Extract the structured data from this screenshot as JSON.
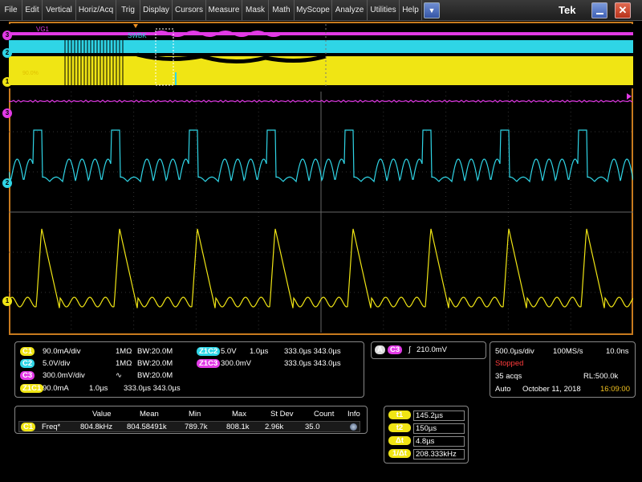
{
  "menu": {
    "items": [
      "File",
      "Edit",
      "Vertical",
      "Horiz/Acq",
      "Trig",
      "Display",
      "Cursors",
      "Measure",
      "Mask",
      "Math",
      "MyScope",
      "Analyze",
      "Utilities",
      "Help"
    ],
    "brand": "Tek",
    "dropdown_glyph": "▼",
    "close_glyph": "✕"
  },
  "overview": {
    "labels": {
      "vg1": "VG1",
      "swbk": "SWBK",
      "cursor_region": "90.0%"
    },
    "channel_markers": [
      "3",
      "2",
      "1"
    ]
  },
  "graticule": {
    "channel_markers": [
      "3",
      "2",
      "1"
    ],
    "trace_colors": {
      "ch1": "#f0e514",
      "ch2": "#2fd5e6",
      "ch3": "#e23ae6",
      "ch4": "#6df05a"
    }
  },
  "vertical_panel": {
    "rows": [
      {
        "badge": "C1",
        "badge_color": "#f0e514",
        "scale": "90.0mA/div",
        "imp": "1MΩ",
        "bw": "BW:20.0M"
      },
      {
        "badge": "C2",
        "badge_color": "#2fd5e6",
        "scale": "5.0V/div",
        "imp": "1MΩ",
        "bw": "BW:20.0M"
      },
      {
        "badge": "C3",
        "badge_color": "#e23ae6",
        "scale": "300.0mV/div",
        "imp": "∿",
        "bw": "BW:20.0M"
      },
      {
        "badge": "Z1C1",
        "badge_color": "#f0e514",
        "scale": "90.0mA",
        "imp": "1.0µs",
        "bw": "333.0µs 343.0µs"
      }
    ],
    "zoom_rows": [
      {
        "badge": "Z1C2",
        "badge_color": "#2fd5e6",
        "scale": "5.0V",
        "div": "1.0µs",
        "range": "333.0µs 343.0µs"
      },
      {
        "badge": "Z1C3",
        "badge_color": "#e23ae6",
        "scale": "300.0mV",
        "div": "",
        "range": "333.0µs 343.0µs"
      }
    ]
  },
  "trigger_panel": {
    "badge_a": "A",
    "badge_src": "C3",
    "slope_glyph": "∫",
    "level": "210.0mV"
  },
  "horizontal_panel": {
    "scale": "500.0µs/div",
    "rate": "100MS/s",
    "resolution": "10.0ns",
    "status": "Stopped",
    "acqs": "35 acqs",
    "record_length": "RL:500.0k",
    "mode": "Auto",
    "date": "October 11, 2018",
    "time": "16:09:00"
  },
  "measurement_table": {
    "headers": [
      "Value",
      "Mean",
      "Min",
      "Max",
      "St Dev",
      "Count",
      "Info"
    ],
    "row": {
      "badge": "C1",
      "name": "Freq*",
      "value": "804.8kHz",
      "mean": "804.58491k",
      "min": "789.7k",
      "max": "808.1k",
      "stdev": "2.96k",
      "count": "35.0"
    }
  },
  "cursor_panel": {
    "rows": [
      {
        "label": "t1",
        "value": "145.2µs"
      },
      {
        "label": "t2",
        "value": "150µs"
      },
      {
        "label": "Δt",
        "value": "4.8µs"
      },
      {
        "label": "1/Δt",
        "value": "208.333kHz"
      }
    ]
  },
  "colors": {
    "frame": "#c77a1e",
    "status_stopped": "#ff3c3c",
    "time_highlight": "#f0c020"
  }
}
